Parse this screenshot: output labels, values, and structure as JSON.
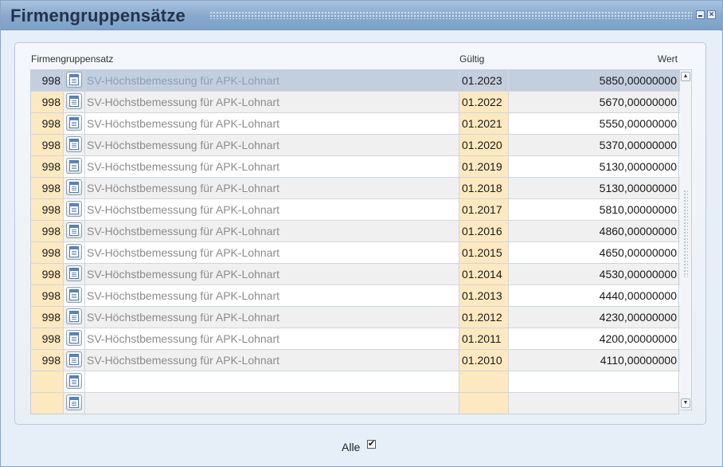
{
  "window": {
    "title": "Firmengruppensätze",
    "minimize_icon": "minimize-icon",
    "close_icon": "close-icon"
  },
  "grid": {
    "columns": {
      "name": "Firmengruppensatz",
      "valid": "Gültig",
      "value": "Wert"
    },
    "rows": [
      {
        "num": "998",
        "text": "SV-Höchstbemessung für APK-Lohnart",
        "date": "01.2023",
        "value": "5850,00000000"
      },
      {
        "num": "998",
        "text": "SV-Höchstbemessung für APK-Lohnart",
        "date": "01.2022",
        "value": "5670,00000000"
      },
      {
        "num": "998",
        "text": "SV-Höchstbemessung für APK-Lohnart",
        "date": "01.2021",
        "value": "5550,00000000"
      },
      {
        "num": "998",
        "text": "SV-Höchstbemessung für APK-Lohnart",
        "date": "01.2020",
        "value": "5370,00000000"
      },
      {
        "num": "998",
        "text": "SV-Höchstbemessung für APK-Lohnart",
        "date": "01.2019",
        "value": "5130,00000000"
      },
      {
        "num": "998",
        "text": "SV-Höchstbemessung für APK-Lohnart",
        "date": "01.2018",
        "value": "5130,00000000"
      },
      {
        "num": "998",
        "text": "SV-Höchstbemessung für APK-Lohnart",
        "date": "01.2017",
        "value": "5810,00000000"
      },
      {
        "num": "998",
        "text": "SV-Höchstbemessung für APK-Lohnart",
        "date": "01.2016",
        "value": "4860,00000000"
      },
      {
        "num": "998",
        "text": "SV-Höchstbemessung für APK-Lohnart",
        "date": "01.2015",
        "value": "4650,00000000"
      },
      {
        "num": "998",
        "text": "SV-Höchstbemessung für APK-Lohnart",
        "date": "01.2014",
        "value": "4530,00000000"
      },
      {
        "num": "998",
        "text": "SV-Höchstbemessung für APK-Lohnart",
        "date": "01.2013",
        "value": "4440,00000000"
      },
      {
        "num": "998",
        "text": "SV-Höchstbemessung für APK-Lohnart",
        "date": "01.2012",
        "value": "4230,00000000"
      },
      {
        "num": "998",
        "text": "SV-Höchstbemessung für APK-Lohnart",
        "date": "01.2011",
        "value": "4200,00000000"
      },
      {
        "num": "998",
        "text": "SV-Höchstbemessung für APK-Lohnart",
        "date": "01.2010",
        "value": "4110,00000000"
      },
      {
        "num": "",
        "text": "",
        "date": "",
        "value": ""
      },
      {
        "num": "",
        "text": "",
        "date": "",
        "value": ""
      }
    ],
    "selected_row": 1,
    "row_icon": "document-icon"
  },
  "footer": {
    "alle_label": "Alle",
    "alle_checked": true,
    "check_glyph": "✔"
  },
  "colors": {
    "title_bar": "#86a8cd",
    "selected_row": "#c3cfdf",
    "highlight_column": "#fde9c0"
  }
}
